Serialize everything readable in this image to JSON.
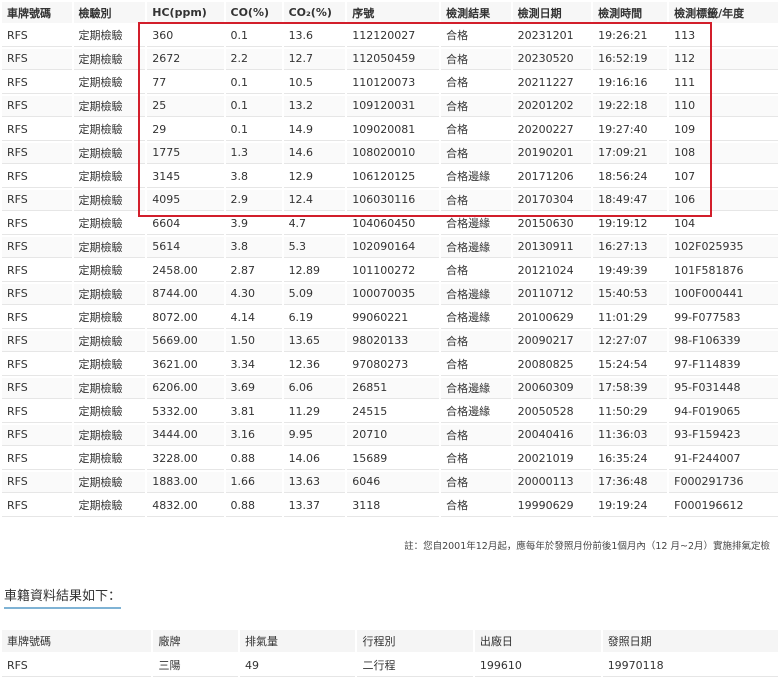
{
  "inspection_table": {
    "headers": [
      "車牌號碼",
      "檢驗別",
      "HC(ppm)",
      "CO(%)",
      "CO₂(%)",
      "序號",
      "檢測結果",
      "檢測日期",
      "檢測時間",
      "檢測標籤/年度"
    ],
    "rows": [
      [
        "RFS",
        "定期檢驗",
        "360",
        "0.1",
        "13.6",
        "112120027",
        "合格",
        "20231201",
        "19:26:21",
        "113"
      ],
      [
        "RFS",
        "定期檢驗",
        "2672",
        "2.2",
        "12.7",
        "112050459",
        "合格",
        "20230520",
        "16:52:19",
        "112"
      ],
      [
        "RFS",
        "定期檢驗",
        "77",
        "0.1",
        "10.5",
        "110120073",
        "合格",
        "20211227",
        "19:16:16",
        "111"
      ],
      [
        "RFS",
        "定期檢驗",
        "25",
        "0.1",
        "13.2",
        "109120031",
        "合格",
        "20201202",
        "19:22:18",
        "110"
      ],
      [
        "RFS",
        "定期檢驗",
        "29",
        "0.1",
        "14.9",
        "109020081",
        "合格",
        "20200227",
        "19:27:40",
        "109"
      ],
      [
        "RFS",
        "定期檢驗",
        "1775",
        "1.3",
        "14.6",
        "108020010",
        "合格",
        "20190201",
        "17:09:21",
        "108"
      ],
      [
        "RFS",
        "定期檢驗",
        "3145",
        "3.8",
        "12.9",
        "106120125",
        "合格邊緣",
        "20171206",
        "18:56:24",
        "107"
      ],
      [
        "RFS",
        "定期檢驗",
        "4095",
        "2.9",
        "12.4",
        "106030116",
        "合格",
        "20170304",
        "18:49:47",
        "106"
      ],
      [
        "RFS",
        "定期檢驗",
        "6604",
        "3.9",
        "4.7",
        "104060450",
        "合格邊緣",
        "20150630",
        "19:19:12",
        "104"
      ],
      [
        "RFS",
        "定期檢驗",
        "5614",
        "3.8",
        "5.3",
        "102090164",
        "合格邊緣",
        "20130911",
        "16:27:13",
        "102F025935"
      ],
      [
        "RFS",
        "定期檢驗",
        "2458.00",
        "2.87",
        "12.89",
        "101100272",
        "合格",
        "20121024",
        "19:49:39",
        "101F581876"
      ],
      [
        "RFS",
        "定期檢驗",
        "8744.00",
        "4.30",
        "5.09",
        "100070035",
        "合格邊緣",
        "20110712",
        "15:40:53",
        "100F000441"
      ],
      [
        "RFS",
        "定期檢驗",
        "8072.00",
        "4.14",
        "6.19",
        "99060221",
        "合格邊緣",
        "20100629",
        "11:01:29",
        "99-F077583"
      ],
      [
        "RFS",
        "定期檢驗",
        "5669.00",
        "1.50",
        "13.65",
        "98020133",
        "合格",
        "20090217",
        "12:27:07",
        "98-F106339"
      ],
      [
        "RFS",
        "定期檢驗",
        "3621.00",
        "3.34",
        "12.36",
        "97080273",
        "合格",
        "20080825",
        "15:24:54",
        "97-F114839"
      ],
      [
        "RFS",
        "定期檢驗",
        "6206.00",
        "3.69",
        "6.06",
        "26851",
        "合格邊緣",
        "20060309",
        "17:58:39",
        "95-F031448"
      ],
      [
        "RFS",
        "定期檢驗",
        "5332.00",
        "3.81",
        "11.29",
        "24515",
        "合格邊緣",
        "20050528",
        "11:50:29",
        "94-F019065"
      ],
      [
        "RFS",
        "定期檢驗",
        "3444.00",
        "3.16",
        "9.95",
        "20710",
        "合格",
        "20040416",
        "11:36:03",
        "93-F159423"
      ],
      [
        "RFS",
        "定期檢驗",
        "3228.00",
        "0.88",
        "14.06",
        "15689",
        "合格",
        "20021019",
        "16:35:24",
        "91-F244007"
      ],
      [
        "RFS",
        "定期檢驗",
        "1883.00",
        "1.66",
        "13.63",
        "6046",
        "合格",
        "20000113",
        "17:36:48",
        "F000291736"
      ],
      [
        "RFS",
        "定期檢驗",
        "4832.00",
        "0.88",
        "13.37",
        "3118",
        "合格",
        "19990629",
        "19:19:24",
        "F000196612"
      ]
    ]
  },
  "note": "註：您自2001年12月起，應每年於發照月份前後1個月內（12 月~2月）實施排氣定檢",
  "vehicle_section": {
    "title": "車籍資料結果如下：",
    "headers": [
      "車牌號碼",
      "廠牌",
      "排氣量",
      "行程別",
      "出廠日",
      "發照日期"
    ],
    "row": [
      "RFS",
      "三陽",
      "49",
      "二行程",
      "199610",
      "19970118"
    ]
  },
  "colors": {
    "highlight_box": "#d21e2b",
    "section_underline": "#7fb3d5"
  }
}
